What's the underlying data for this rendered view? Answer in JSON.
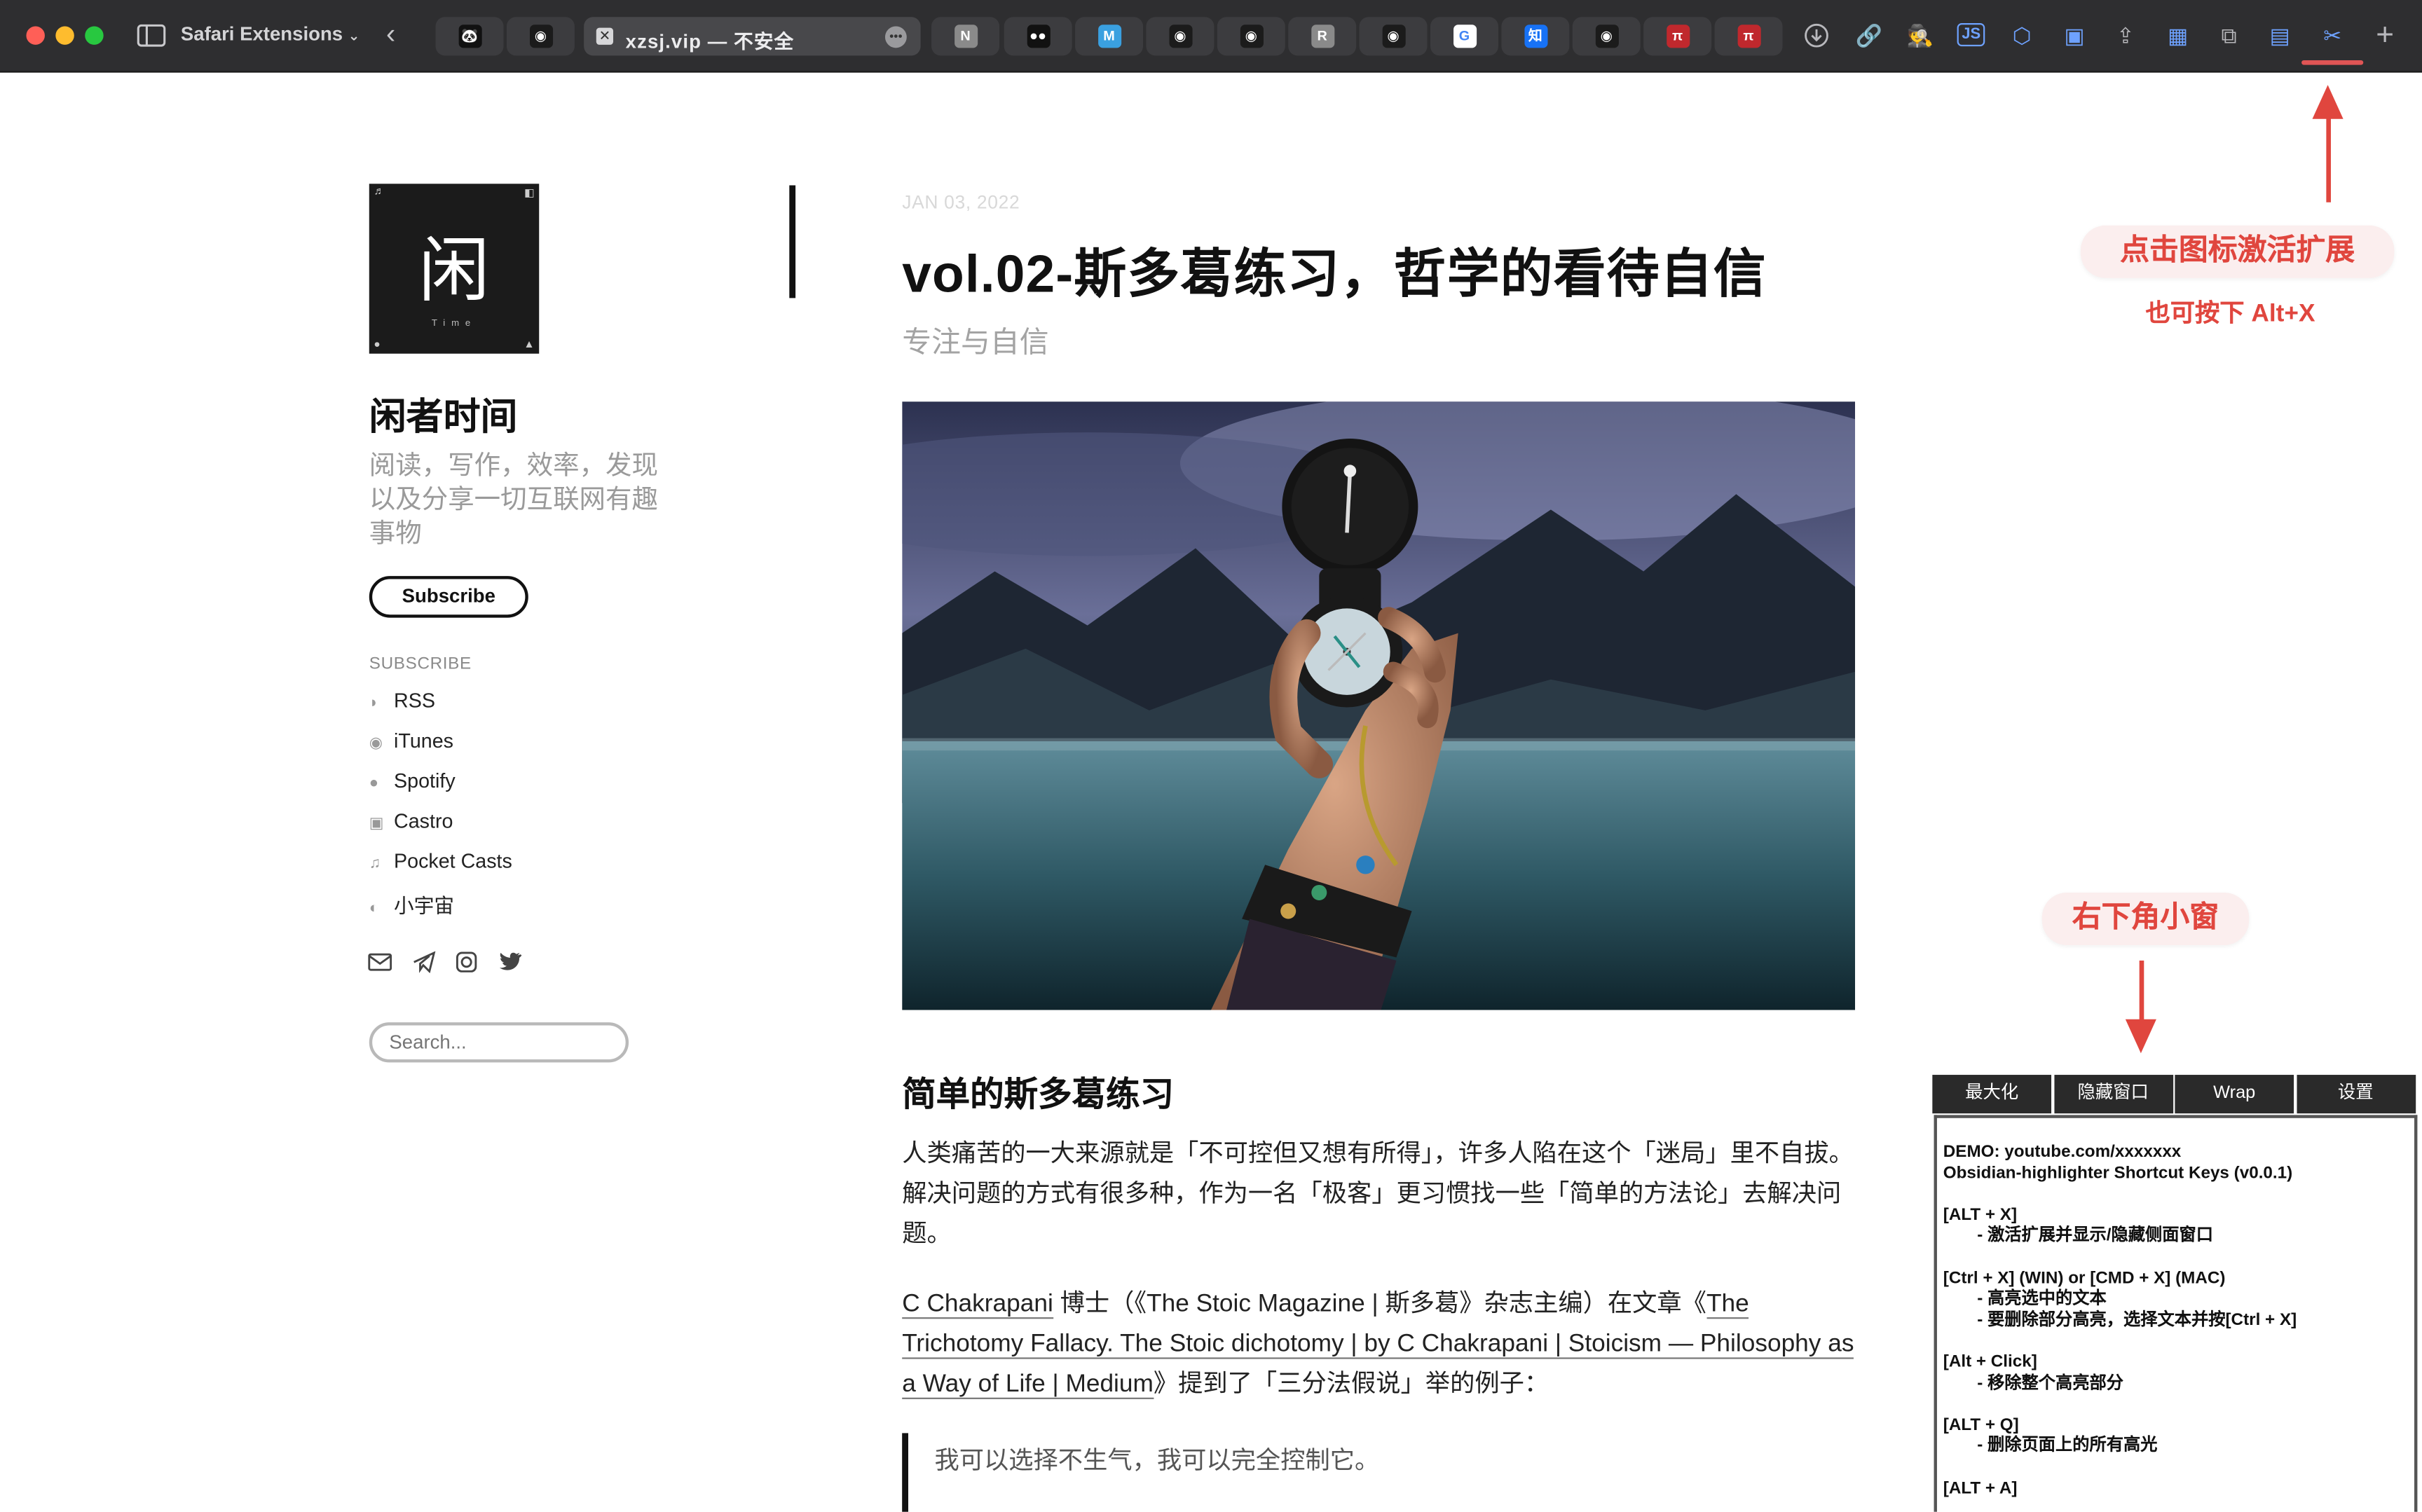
{
  "toolbar": {
    "extension_label": "Safari Extensions",
    "active_tab_title": "xzsj.vip — 不安全",
    "tab_favicons": [
      {
        "label": "🐼",
        "bg": "#111111"
      },
      {
        "label": "◉",
        "bg": "#1b1b1b"
      },
      {
        "label": "N",
        "bg": "#8a8a8a"
      },
      {
        "label": "●●",
        "bg": "#111111"
      },
      {
        "label": "M",
        "bg": "#3aa0e0"
      },
      {
        "label": "◉",
        "bg": "#1b1b1b"
      },
      {
        "label": "◉",
        "bg": "#1b1b1b"
      },
      {
        "label": "R",
        "bg": "#8a8a8a"
      },
      {
        "label": "◉",
        "bg": "#1b1b1b"
      },
      {
        "label": "G",
        "bg": "#ffffff"
      },
      {
        "label": "知",
        "bg": "#1772f6"
      },
      {
        "label": "◉",
        "bg": "#1b1b1b"
      },
      {
        "label": "π",
        "bg": "#c0282d"
      },
      {
        "label": "π",
        "bg": "#c0282d"
      }
    ]
  },
  "sidebar": {
    "logo_char": "闲",
    "logo_sub": "Time",
    "site_title": "闲者时间",
    "site_description": "阅读，写作，效率，发现以及分享一切互联网有趣事物",
    "subscribe_button": "Subscribe",
    "subscribe_heading": "SUBSCRIBE",
    "subscribe_items": [
      {
        "icon": "rss-icon",
        "label": "RSS"
      },
      {
        "icon": "podcast-icon",
        "label": "iTunes"
      },
      {
        "icon": "spotify-icon",
        "label": "Spotify"
      },
      {
        "icon": "castro-icon",
        "label": "Castro"
      },
      {
        "icon": "music-note-icon",
        "label": "Pocket Casts"
      },
      {
        "icon": "planet-icon",
        "label": "小宇宙"
      }
    ],
    "search_placeholder": "Search..."
  },
  "article": {
    "date": "JAN 03, 2022",
    "title": "vol.02-斯多葛练习，哲学的看待自信",
    "subtitle": "专注与自信",
    "section_heading": "简单的斯多葛练习",
    "paragraph1": "人类痛苦的一大来源就是「不可控但又想有所得」，许多人陷在这个「迷局」里不自拔。解决问题的方式有很多种，作为一名「极客」更习惯找一些「简单的方法论」去解决问题。",
    "paragraph2_link1": "C Chakrapani",
    "paragraph2_mid": " 博士（《The Stoic Magazine | 斯多葛》杂志主编）在文章《",
    "paragraph2_link2": "The Trichotomy Fallacy. The Stoic dichotomy | by C Chakrapani | Stoicism — Philosophy as a Way of Life | Medium",
    "paragraph2_end": "》提到了「三分法假说」举的例子：",
    "quote": "我可以选择不生气，我可以完全控制它。"
  },
  "annotations": {
    "top_bubble": "点击图标激活扩展",
    "top_sub": "也可按下 Alt+X",
    "bottom_bubble": "右下角小窗",
    "accent_color": "#e0463e"
  },
  "mini_window": {
    "buttons": [
      "最大化",
      "隐藏窗口",
      "Wrap",
      "设置"
    ],
    "lines": [
      {
        "text": "DEMO: youtube.com/xxxxxxx",
        "indent": false
      },
      {
        "text": "Obsidian-highlighter Shortcut Keys (v0.0.1)",
        "indent": false
      },
      {
        "text": "",
        "indent": false
      },
      {
        "text": "[ALT + X]",
        "indent": false
      },
      {
        "text": "- 激活扩展并显示/隐藏侧面窗口",
        "indent": true
      },
      {
        "text": "",
        "indent": false
      },
      {
        "text": "[Ctrl + X] (WIN) or [CMD + X] (MAC)",
        "indent": false
      },
      {
        "text": "- 高亮选中的文本",
        "indent": true
      },
      {
        "text": "- 要删除部分高亮，选择文本并按[Ctrl + X]",
        "indent": true
      },
      {
        "text": "",
        "indent": false
      },
      {
        "text": "[Alt + Click]",
        "indent": false
      },
      {
        "text": "- 移除整个高亮部分",
        "indent": true
      },
      {
        "text": "",
        "indent": false
      },
      {
        "text": "[ALT + Q]",
        "indent": false
      },
      {
        "text": "- 删除页面上的所有高光",
        "indent": true
      },
      {
        "text": "",
        "indent": false
      },
      {
        "text": "[ALT + A]",
        "indent": false
      }
    ]
  }
}
